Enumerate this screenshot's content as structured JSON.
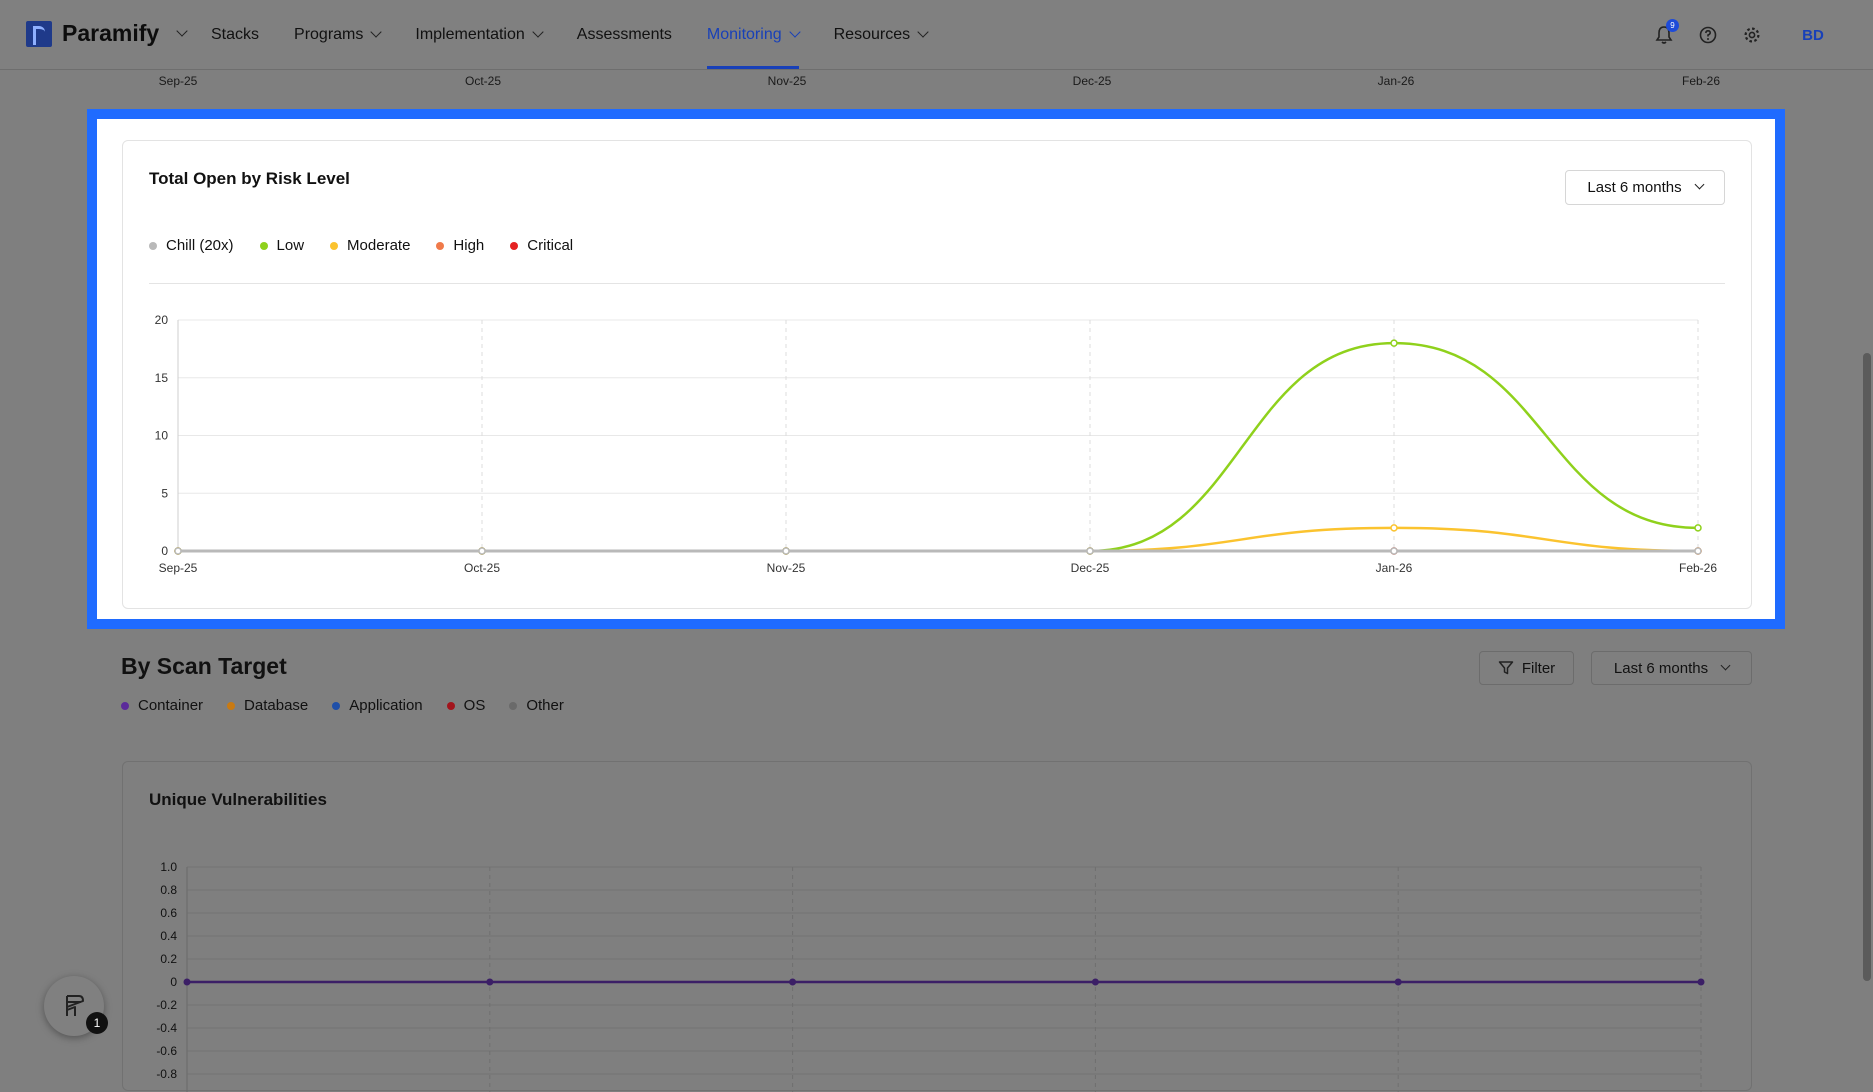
{
  "nav": {
    "brand": "Paramify",
    "links": [
      {
        "label": "Stacks"
      },
      {
        "label": "Programs"
      },
      {
        "label": "Implementation"
      },
      {
        "label": "Assessments"
      },
      {
        "label": "Monitoring"
      },
      {
        "label": "Resources"
      }
    ],
    "active": "Monitoring",
    "notification_count": "9",
    "avatar": "BD"
  },
  "top_axis_labels": [
    "Sep-25",
    "Oct-25",
    "Nov-25",
    "Dec-25",
    "Jan-26",
    "Feb-26"
  ],
  "risk_card": {
    "title": "Total Open by Risk Level",
    "range": "Last 6 months",
    "legend": [
      {
        "label": "Chill (20x)",
        "color": "#b9b9b9"
      },
      {
        "label": "Low",
        "color": "#8fd11c"
      },
      {
        "label": "Moderate",
        "color": "#fbc32f"
      },
      {
        "label": "High",
        "color": "#f07a4a"
      },
      {
        "label": "Critical",
        "color": "#e52222"
      }
    ]
  },
  "scan_section": {
    "title": "By Scan Target",
    "filter_label": "Filter",
    "range": "Last 6 months",
    "legend": [
      {
        "label": "Container",
        "color": "#5b2a9a"
      },
      {
        "label": "Database",
        "color": "#c97a12"
      },
      {
        "label": "Application",
        "color": "#1f4fa8"
      },
      {
        "label": "OS",
        "color": "#a2141c"
      },
      {
        "label": "Other",
        "color": "#6a6a6a"
      }
    ]
  },
  "vuln_card": {
    "title": "Unique Vulnerabilities"
  },
  "floating_badge": "1",
  "chart_data": [
    {
      "type": "line",
      "categories": [
        "Sep-25",
        "Oct-25",
        "Nov-25",
        "Dec-25",
        "Jan-26",
        "Feb-26"
      ],
      "ylim": [
        0,
        20
      ],
      "yticks": [
        0,
        5,
        10,
        15,
        20
      ],
      "series": [
        {
          "name": "Chill (20x)",
          "color": "#b9b9b9",
          "values": [
            0,
            0,
            0,
            0,
            0,
            0
          ]
        },
        {
          "name": "Low",
          "color": "#8fd11c",
          "values": [
            0,
            0,
            0,
            0,
            18,
            2
          ]
        },
        {
          "name": "Moderate",
          "color": "#fbc32f",
          "values": [
            0,
            0,
            0,
            0,
            2,
            0
          ]
        },
        {
          "name": "High",
          "color": "#f07a4a",
          "values": [
            0,
            0,
            0,
            0,
            0,
            0
          ]
        },
        {
          "name": "Critical",
          "color": "#e52222",
          "values": [
            0,
            0,
            0,
            0,
            0,
            0
          ]
        }
      ]
    },
    {
      "type": "line",
      "categories": [
        "Sep-25",
        "Oct-25",
        "Nov-25",
        "Dec-25",
        "Jan-26",
        "Feb-26"
      ],
      "ylim": [
        -0.8,
        1.0
      ],
      "yticks": [
        "1.0",
        "0.8",
        "0.6",
        "0.4",
        "0.2",
        "0",
        "-0.2",
        "-0.4",
        "-0.6",
        "-0.8"
      ],
      "series": [
        {
          "name": "Container",
          "color": "#5b2a9a",
          "values": [
            0,
            0,
            0,
            0,
            0,
            0
          ]
        }
      ]
    }
  ]
}
